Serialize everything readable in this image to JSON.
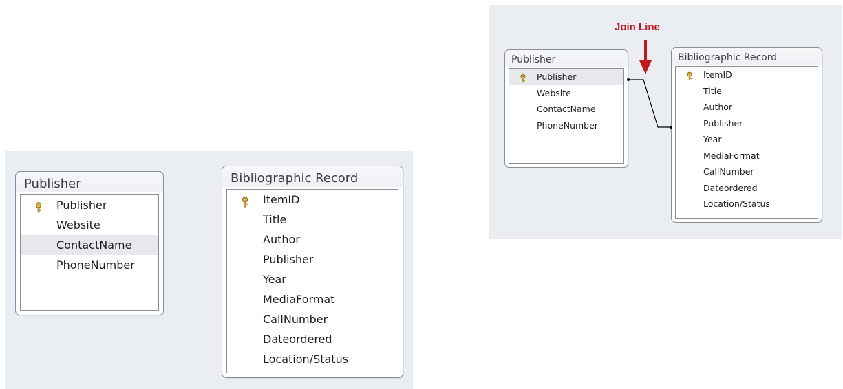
{
  "colors": {
    "panel_background": "#eaedf1",
    "join_label": "#c0171d",
    "arrow": "#c0171d",
    "join_line": "#000000"
  },
  "icons": {
    "primary_key": "key-icon"
  },
  "left_view": {
    "publisher_table": {
      "title": "Publisher",
      "fields": [
        {
          "label": "Publisher",
          "primary_key": true
        },
        {
          "label": "Website",
          "primary_key": false
        },
        {
          "label": "ContactName",
          "primary_key": false,
          "selected": true
        },
        {
          "label": "PhoneNumber",
          "primary_key": false
        }
      ]
    },
    "bibliographic_table": {
      "title": "Bibliographic Record",
      "fields": [
        {
          "label": "ItemID",
          "primary_key": true
        },
        {
          "label": "Title"
        },
        {
          "label": "Author"
        },
        {
          "label": "Publisher"
        },
        {
          "label": "Year"
        },
        {
          "label": "MediaFormat"
        },
        {
          "label": "CallNumber"
        },
        {
          "label": "Dateordered"
        },
        {
          "label": "Location/Status"
        }
      ]
    }
  },
  "right_view": {
    "annotation": "Join Line",
    "publisher_table": {
      "title": "Publisher",
      "fields": [
        {
          "label": "Publisher",
          "primary_key": true,
          "selected": true
        },
        {
          "label": "Website"
        },
        {
          "label": "ContactName"
        },
        {
          "label": "PhoneNumber"
        }
      ]
    },
    "bibliographic_table": {
      "title": "Bibliographic Record",
      "fields": [
        {
          "label": "ItemID",
          "primary_key": true
        },
        {
          "label": "Title"
        },
        {
          "label": "Author"
        },
        {
          "label": "Publisher"
        },
        {
          "label": "Year"
        },
        {
          "label": "MediaFormat"
        },
        {
          "label": "CallNumber"
        },
        {
          "label": "Dateordered"
        },
        {
          "label": "Location/Status"
        }
      ]
    }
  }
}
